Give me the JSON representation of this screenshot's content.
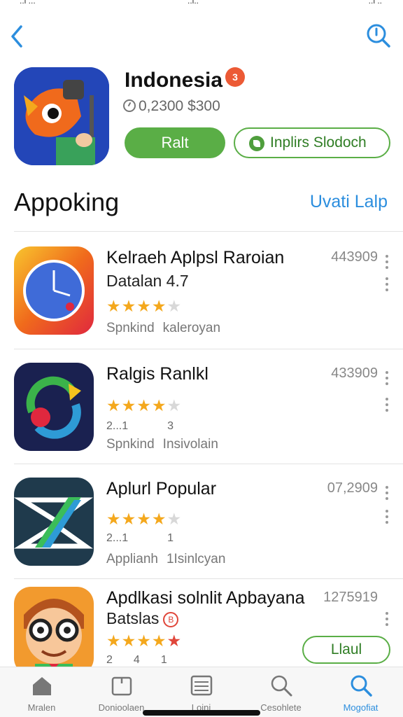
{
  "status_bar": {
    "left": "..l ...",
    "center": "..l..",
    "right": "..l .."
  },
  "nav": {
    "back_icon": "chevron-left-icon",
    "search_icon": "search-icon"
  },
  "hero": {
    "title": "Indonesia",
    "badge": "3",
    "meta": "0,2300 $300",
    "primary_button": "Ralt",
    "secondary_button": "Inplirs Slodoch"
  },
  "section": {
    "title": "Appoking",
    "link": "Uvati Lalp"
  },
  "apps": [
    {
      "title": "Kelraeh Aplpsl Raroian",
      "subtitle": "Datalan 4.7",
      "count": "443909",
      "rating": 3.5,
      "stats": [],
      "footer_a": "Spnkind",
      "footer_b": "kaleroyan",
      "icon": "clock-app-icon"
    },
    {
      "title": "Ralgis Ranlkl",
      "subtitle": "",
      "count": "433909",
      "rating": 3.5,
      "stats": [
        "2...1",
        "3"
      ],
      "footer_a": "Spnkind",
      "footer_b": "Insivolain",
      "icon": "refresh-app-icon"
    },
    {
      "title": "Aplurl Popular",
      "subtitle": "",
      "count": "07,2909",
      "rating": 3.5,
      "stats": [
        "2...1",
        "1"
      ],
      "footer_a": "Applianh",
      "footer_b": "1Isinlcyan",
      "icon": "x-logo-app-icon"
    },
    {
      "title": "Apdlkasi solnlit Apbayana",
      "subtitle": "Batslas",
      "subtitle_badge": "B",
      "count": "1275919",
      "rating": 4.5,
      "stats": [
        "2",
        "4",
        "1"
      ],
      "button": "Llaul",
      "icon": "cartoon-character-app-icon"
    }
  ],
  "tabs": [
    {
      "label": "Mralen",
      "icon": "home-icon",
      "active": false
    },
    {
      "label": "Donioolaen",
      "icon": "calendar-icon",
      "active": false
    },
    {
      "label": "Loini",
      "icon": "grid-icon",
      "active": false
    },
    {
      "label": "Cesohlete",
      "icon": "search-icon",
      "active": false
    },
    {
      "label": "Mogofiat",
      "icon": "search-icon",
      "active": true
    }
  ],
  "colors": {
    "accent": "#2c8ede",
    "green": "#5aae46",
    "star": "#f4a81d",
    "badge": "#ec5a35"
  }
}
